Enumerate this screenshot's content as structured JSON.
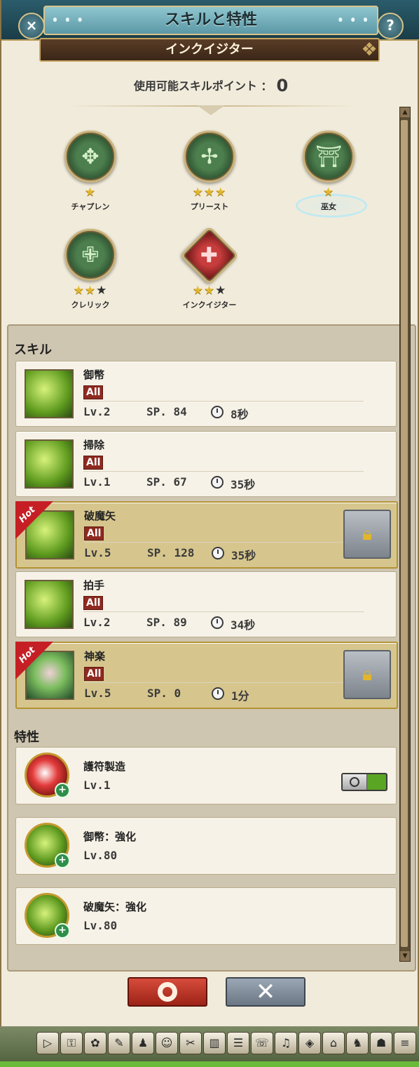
{
  "window": {
    "title": "スキルと特性",
    "title_dots_left": "• • •",
    "title_dots_right": "• • •",
    "subtitle": "インクイジター",
    "close_glyph": "×",
    "help_glyph": "?"
  },
  "skill_points": {
    "label": "使用可能スキルポイント ：",
    "value": "0"
  },
  "classes": [
    {
      "name": "チャプレン",
      "stars_on": "★",
      "stars_off": "",
      "emblem": "wheel-icon"
    },
    {
      "name": "プリースト",
      "stars_on": "★★★",
      "stars_off": "",
      "emblem": "cross-leaf-icon"
    },
    {
      "name": "巫女",
      "stars_on": "★",
      "stars_off": "",
      "emblem": "shrine-icon",
      "selected": true
    },
    {
      "name": "クレリック",
      "stars_on": "★★",
      "stars_off": "★",
      "emblem": "holy-cross-icon"
    },
    {
      "name": "インクイジター",
      "stars_on": "★★",
      "stars_off": "★",
      "emblem": "red-seal-icon"
    }
  ],
  "skills_section": {
    "title": "スキル",
    "skills": [
      {
        "name": "御幣",
        "tag": "All",
        "level": "Lv.2",
        "sp": "SP. 84",
        "cooldown": "8秒",
        "hot": false
      },
      {
        "name": "掃除",
        "tag": "All",
        "level": "Lv.1",
        "sp": "SP. 67",
        "cooldown": "35秒",
        "hot": false
      },
      {
        "name": "破魔矢",
        "tag": "All",
        "level": "Lv.5",
        "sp": "SP. 128",
        "cooldown": "35秒",
        "hot": true,
        "hot_label": "Hot",
        "locked": true
      },
      {
        "name": "拍手",
        "tag": "All",
        "level": "Lv.2",
        "sp": "SP. 89",
        "cooldown": "34秒",
        "hot": false
      },
      {
        "name": "神楽",
        "tag": "All",
        "level": "Lv.5",
        "sp": "SP. 0",
        "cooldown": "1分",
        "hot": true,
        "hot_label": "Hot",
        "locked": true
      }
    ]
  },
  "traits_section": {
    "title": "特性",
    "traits": [
      {
        "name": "護符製造",
        "level": "Lv.1",
        "toggle": true
      },
      {
        "name": "御幣：強化",
        "level": "Lv.80",
        "toggle": false
      },
      {
        "name": "破魔矢：強化",
        "level": "Lv.80",
        "toggle": false
      }
    ]
  },
  "buttons": {
    "ok_icon": "circle-ok-icon",
    "cancel_glyph": "✕"
  },
  "dock_icons": [
    "▷",
    "⚿",
    "✿",
    "✎",
    "♟",
    "☺",
    "✂",
    "▥",
    "☰",
    "☏",
    "♫",
    "◈",
    "⌂",
    "♞",
    "☗",
    "≡"
  ]
}
